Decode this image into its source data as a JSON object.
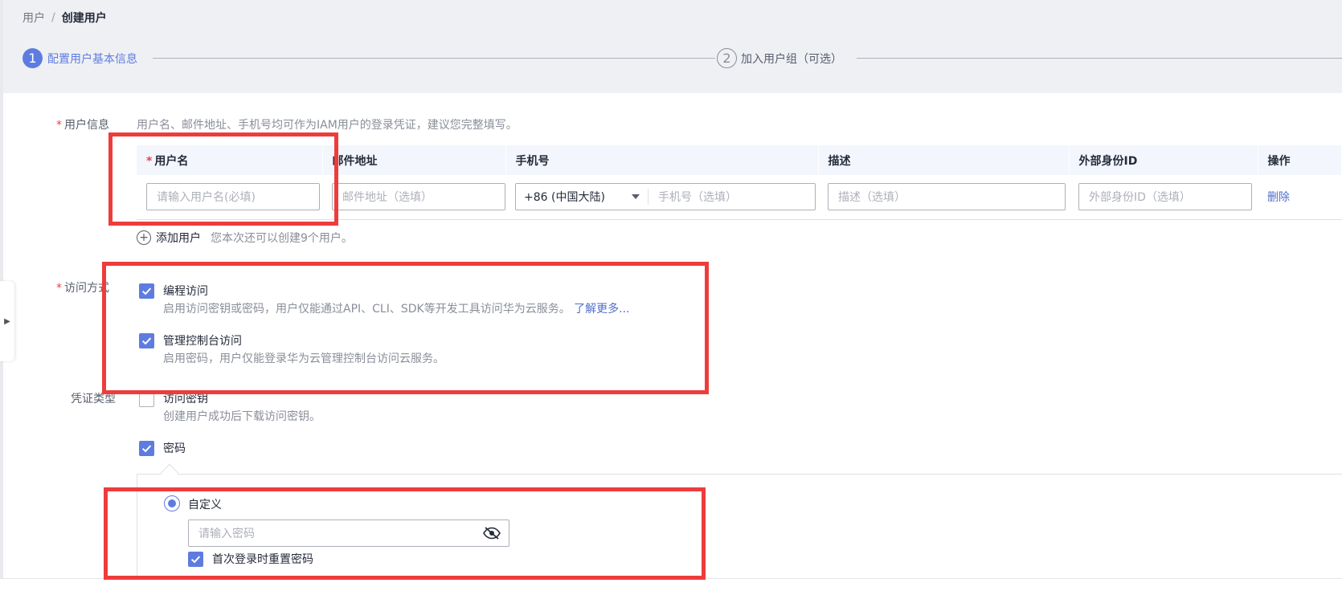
{
  "breadcrumb": {
    "parent": "用户",
    "separator": "/",
    "current": "创建用户"
  },
  "steps": [
    {
      "number": "1",
      "label": "配置用户基本信息"
    },
    {
      "number": "2",
      "label": "加入用户组（可选）"
    }
  ],
  "user_info": {
    "label": "用户信息",
    "hint": "用户名、邮件地址、手机号均可作为IAM用户的登录凭证，建议您完整填写。",
    "columns": [
      "用户名",
      "邮件地址",
      "手机号",
      "描述",
      "外部身份ID",
      "操作"
    ],
    "row": {
      "username_placeholder": "请输入用户名(必填)",
      "email_placeholder": "邮件地址（选填）",
      "phone_code": "+86 (中国大陆)",
      "phone_placeholder": "手机号（选填）",
      "desc_placeholder": "描述（选填）",
      "external_id_placeholder": "外部身份ID（选填）",
      "delete_label": "删除"
    },
    "add_user_label": "添加用户",
    "add_user_hint": "您本次还可以创建9个用户。"
  },
  "access": {
    "label": "访问方式",
    "options": [
      {
        "title": "编程访问",
        "desc": "启用访问密钥或密码，用户仅能通过API、CLI、SDK等开发工具访问华为云服务。",
        "link": "了解更多...",
        "checked": true
      },
      {
        "title": "管理控制台访问",
        "desc": "启用密码，用户仅能登录华为云管理控制台访问云服务。",
        "checked": true
      }
    ]
  },
  "credential": {
    "label": "凭证类型",
    "options": [
      {
        "title": "访问密钥",
        "desc": "创建用户成功后下载访问密钥。",
        "checked": false
      },
      {
        "title": "密码",
        "checked": true
      }
    ],
    "password": {
      "radio_label": "自定义",
      "input_placeholder": "请输入密码",
      "reset_label": "首次登录时重置密码"
    }
  },
  "colors": {
    "accent": "#5e7ce0",
    "highlight_box": "#ee3c3c",
    "required": "#e54545"
  }
}
